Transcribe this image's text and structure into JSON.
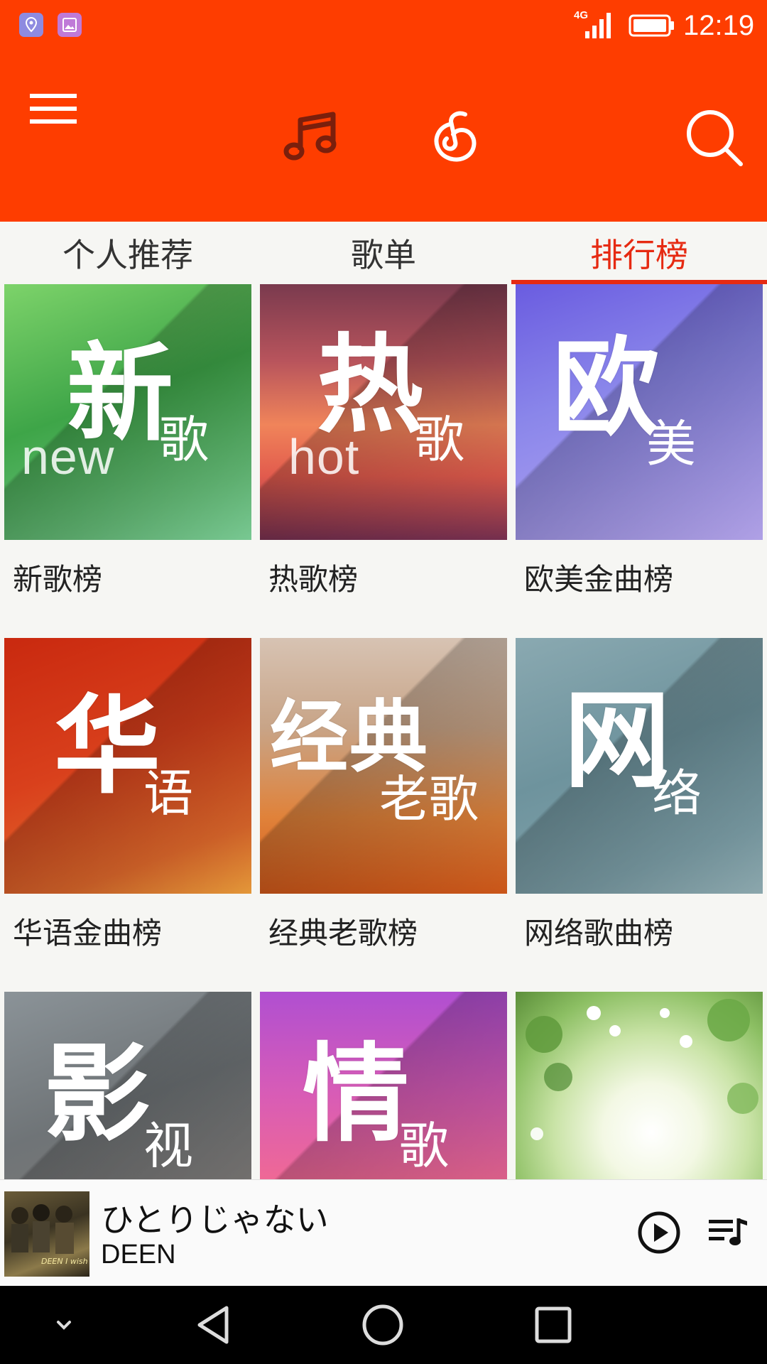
{
  "status_bar": {
    "network_label": "4G",
    "time": "12:19",
    "icons": [
      "location-notification-icon",
      "gallery-notification-icon",
      "signal-icon",
      "battery-icon"
    ]
  },
  "toolbar": {
    "icons": [
      "menu-icon",
      "music-note-icon",
      "netease-logo-icon",
      "search-icon"
    ]
  },
  "tabs": [
    {
      "label": "个人推荐",
      "active": false
    },
    {
      "label": "歌单",
      "active": false
    },
    {
      "label": "排行榜",
      "active": true
    }
  ],
  "charts": [
    {
      "title": "新歌榜",
      "cover_main": "新",
      "cover_sub": "歌",
      "cover_latin": "new"
    },
    {
      "title": "热歌榜",
      "cover_main": "热",
      "cover_sub": "歌",
      "cover_latin": "hot"
    },
    {
      "title": "欧美金曲榜",
      "cover_main": "欧",
      "cover_sub": "美",
      "cover_latin": ""
    },
    {
      "title": "华语金曲榜",
      "cover_main": "华",
      "cover_sub": "语",
      "cover_latin": ""
    },
    {
      "title": "经典老歌榜",
      "cover_main": "经典",
      "cover_sub": "老歌",
      "cover_latin": ""
    },
    {
      "title": "网络歌曲榜",
      "cover_main": "网",
      "cover_sub": "络",
      "cover_latin": ""
    },
    {
      "title": "",
      "cover_main": "影",
      "cover_sub": "视",
      "cover_latin": ""
    },
    {
      "title": "",
      "cover_main": "情",
      "cover_sub": "歌",
      "cover_latin": ""
    },
    {
      "title": "",
      "cover_main": "",
      "cover_sub": "",
      "cover_latin": ""
    }
  ],
  "player": {
    "song_title": "ひとりじゃない",
    "artist": "DEEN",
    "album_art_text": "DEEN I wish"
  },
  "colors": {
    "brand": "#fe3d00",
    "tab_active": "#e62a12",
    "background": "#f6f6f3"
  }
}
